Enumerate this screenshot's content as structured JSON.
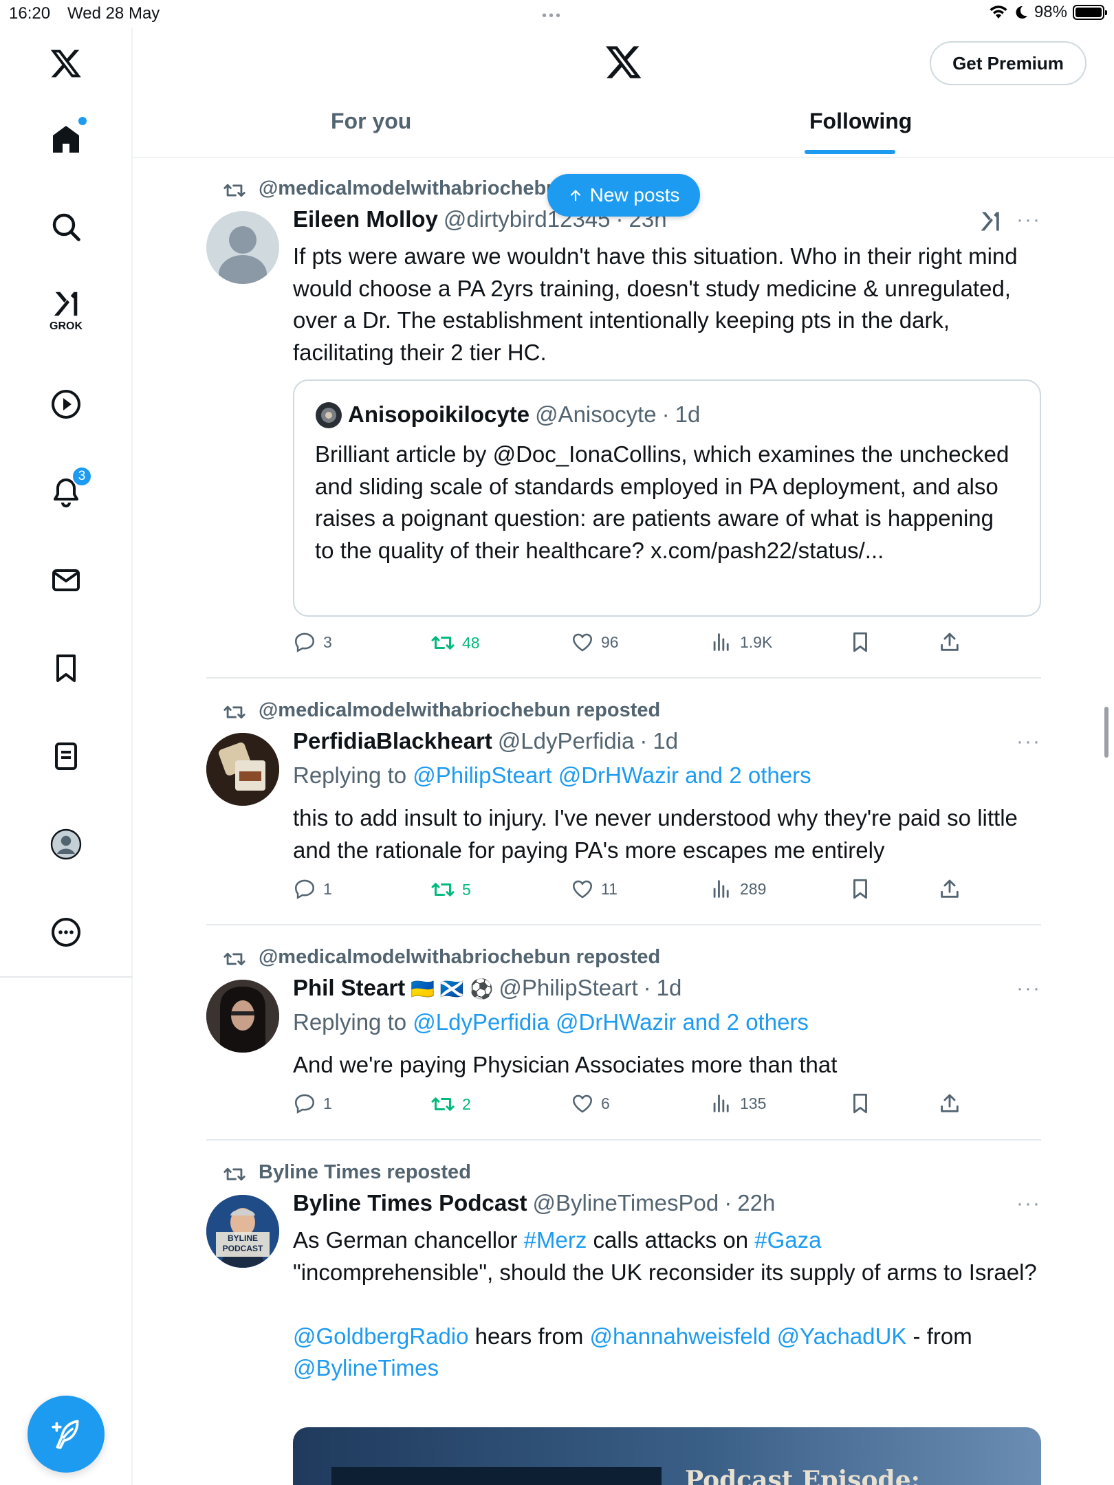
{
  "status": {
    "time": "16:20",
    "date": "Wed 28 May",
    "battery": "98%"
  },
  "header": {
    "premium_label": "Get Premium",
    "tabs": [
      "For you",
      "Following"
    ],
    "active_tab": 1
  },
  "sidebar": {
    "grok_label": "GROK",
    "notification_count": "3"
  },
  "new_posts_label": "New posts",
  "posts": [
    {
      "reposted_by": "@medicalmodelwithabriochebun reposted",
      "name": "Eileen Molloy",
      "handle": "@dirtybird12345",
      "time": "23h",
      "text": "If pts were aware we wouldn't have this situation. Who in their right mind would choose a PA 2yrs training, doesn't study medicine & unregulated, over a Dr. The establishment intentionally keeping pts in the dark, facilitating their 2 tier HC.",
      "quote": {
        "name": "Anisopoikilocyte",
        "handle": "@Anisocyte",
        "time": "1d",
        "text": "Brilliant article by @Doc_IonaCollins, which examines the unchecked and sliding scale of standards employed in PA deployment, and also raises a poignant question: are patients aware of what is happening to the quality of their healthcare? x.com/pash22/status/..."
      },
      "stats": {
        "replies": "3",
        "reposts": "48",
        "likes": "96",
        "views": "1.9K"
      }
    },
    {
      "reposted_by": "@medicalmodelwithabriochebun reposted",
      "name": "PerfidiaBlackheart",
      "handle": "@LdyPerfidia",
      "time": "1d",
      "replying_prefix": "Replying to ",
      "replying_to": "@PhilipSteart @DrHWazir and 2 others",
      "text": "this to add insult to injury.  I've never understood why they're paid so little and the rationale for paying PA's more escapes me entirely",
      "stats": {
        "replies": "1",
        "reposts": "5",
        "likes": "11",
        "views": "289"
      }
    },
    {
      "reposted_by": "@medicalmodelwithabriochebun reposted",
      "name": "Phil Steart",
      "name_emojis": "🇺🇦 🏴󠁧󠁢󠁳󠁣󠁴󠁿 ⚽",
      "handle": "@PhilipSteart",
      "time": "1d",
      "replying_prefix": "Replying to ",
      "replying_to": "@LdyPerfidia @DrHWazir and 2 others",
      "text": "And we're paying Physician Associates more than that",
      "stats": {
        "replies": "1",
        "reposts": "2",
        "likes": "6",
        "views": "135"
      }
    },
    {
      "reposted_by": "Byline Times reposted",
      "name": "Byline Times Podcast",
      "handle": "@BylineTimesPod",
      "time": "22h",
      "text_parts": {
        "a": "As German chancellor ",
        "b": "#Merz",
        "c": " calls attacks on ",
        "d": "#Gaza",
        "e": "\"incomprehensible\", should the UK reconsider its supply of arms to Israel?",
        "f": "@GoldbergRadio",
        "g": " hears from ",
        "h": "@hannahweisfeld",
        "i": " ",
        "j": "@YachadUK",
        "k": " - from",
        "l": "@BylineTimes"
      },
      "avatar_text": "BYLINE PODCAST",
      "media_caption": "Podcast Episode:"
    }
  ]
}
